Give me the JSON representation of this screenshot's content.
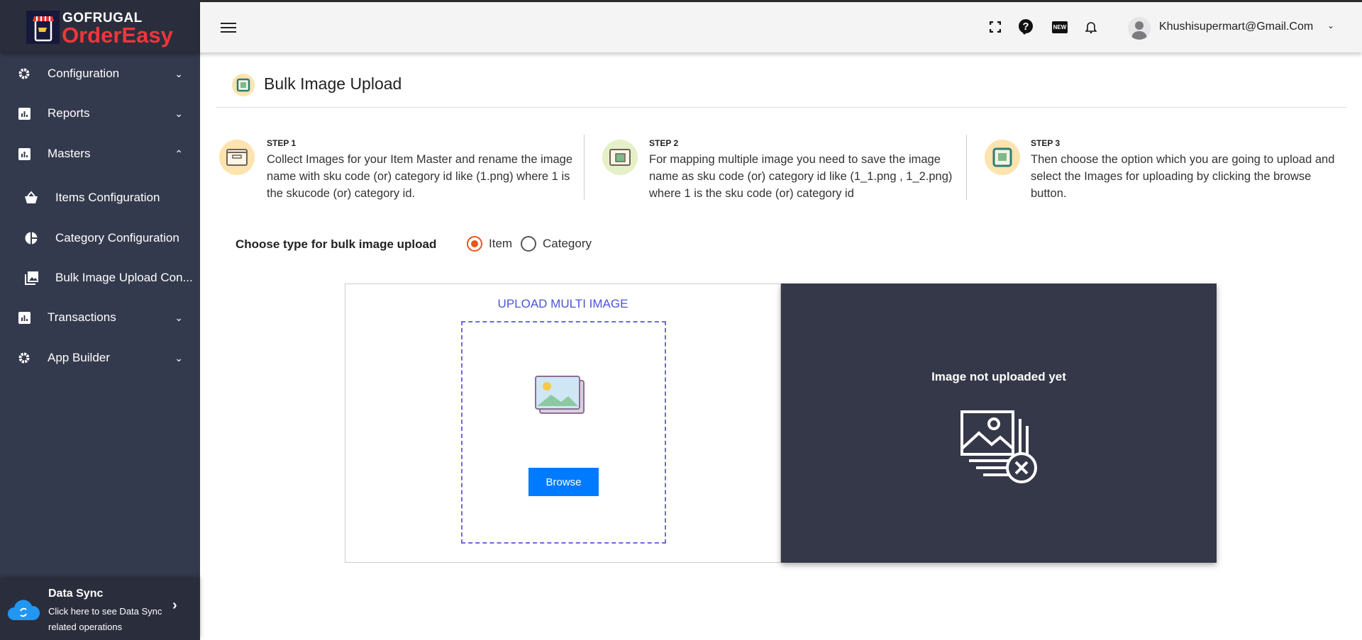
{
  "brand": {
    "line1": "GOFRUGAL",
    "line2": "OrderEasy"
  },
  "sidebar": {
    "items": [
      {
        "label": "Configuration",
        "icon": "gear-icon",
        "expanded": false
      },
      {
        "label": "Reports",
        "icon": "chart-icon",
        "expanded": false
      },
      {
        "label": "Masters",
        "icon": "chart-icon",
        "expanded": true
      },
      {
        "label": "Items Configuration",
        "icon": "basket-icon"
      },
      {
        "label": "Category Configuration",
        "icon": "pie-icon"
      },
      {
        "label": "Bulk Image Upload Con...",
        "icon": "images-icon"
      },
      {
        "label": "Transactions",
        "icon": "chart-icon",
        "expanded": false
      },
      {
        "label": "App Builder",
        "icon": "gear-icon",
        "expanded": false
      }
    ],
    "sync": {
      "title": "Data Sync",
      "line1": "Click here to see Data Sync",
      "line2": "related operations"
    }
  },
  "header": {
    "user": "Khushisupermart@Gmail.Com",
    "new_badge": "NEW"
  },
  "page": {
    "title": "Bulk Image Upload",
    "steps": [
      {
        "label": "STEP 1",
        "text": "Collect Images for your Item Master and rename the image name with sku code (or) category id like (1.png) where 1 is the skucode (or) category id."
      },
      {
        "label": "STEP 2",
        "text": "For mapping multiple image you need to save the image name as sku code (or) category id like (1_1.png , 1_2.png) where 1 is the sku code (or) category id"
      },
      {
        "label": "STEP 3",
        "text": "Then choose the option which you are going to upload and select the Images for uploading by clicking the browse button."
      }
    ],
    "choose_label": "Choose type for bulk image upload",
    "options": [
      {
        "label": "Item",
        "selected": true
      },
      {
        "label": "Category",
        "selected": false
      }
    ],
    "upload_title": "UPLOAD MULTI IMAGE",
    "browse_label": "Browse",
    "preview_text": "Image not uploaded yet"
  },
  "colors": {
    "accent": "#007bff",
    "radio": "#e8541c",
    "sidebar": "#343a4d",
    "brand_red": "#f0363d"
  }
}
